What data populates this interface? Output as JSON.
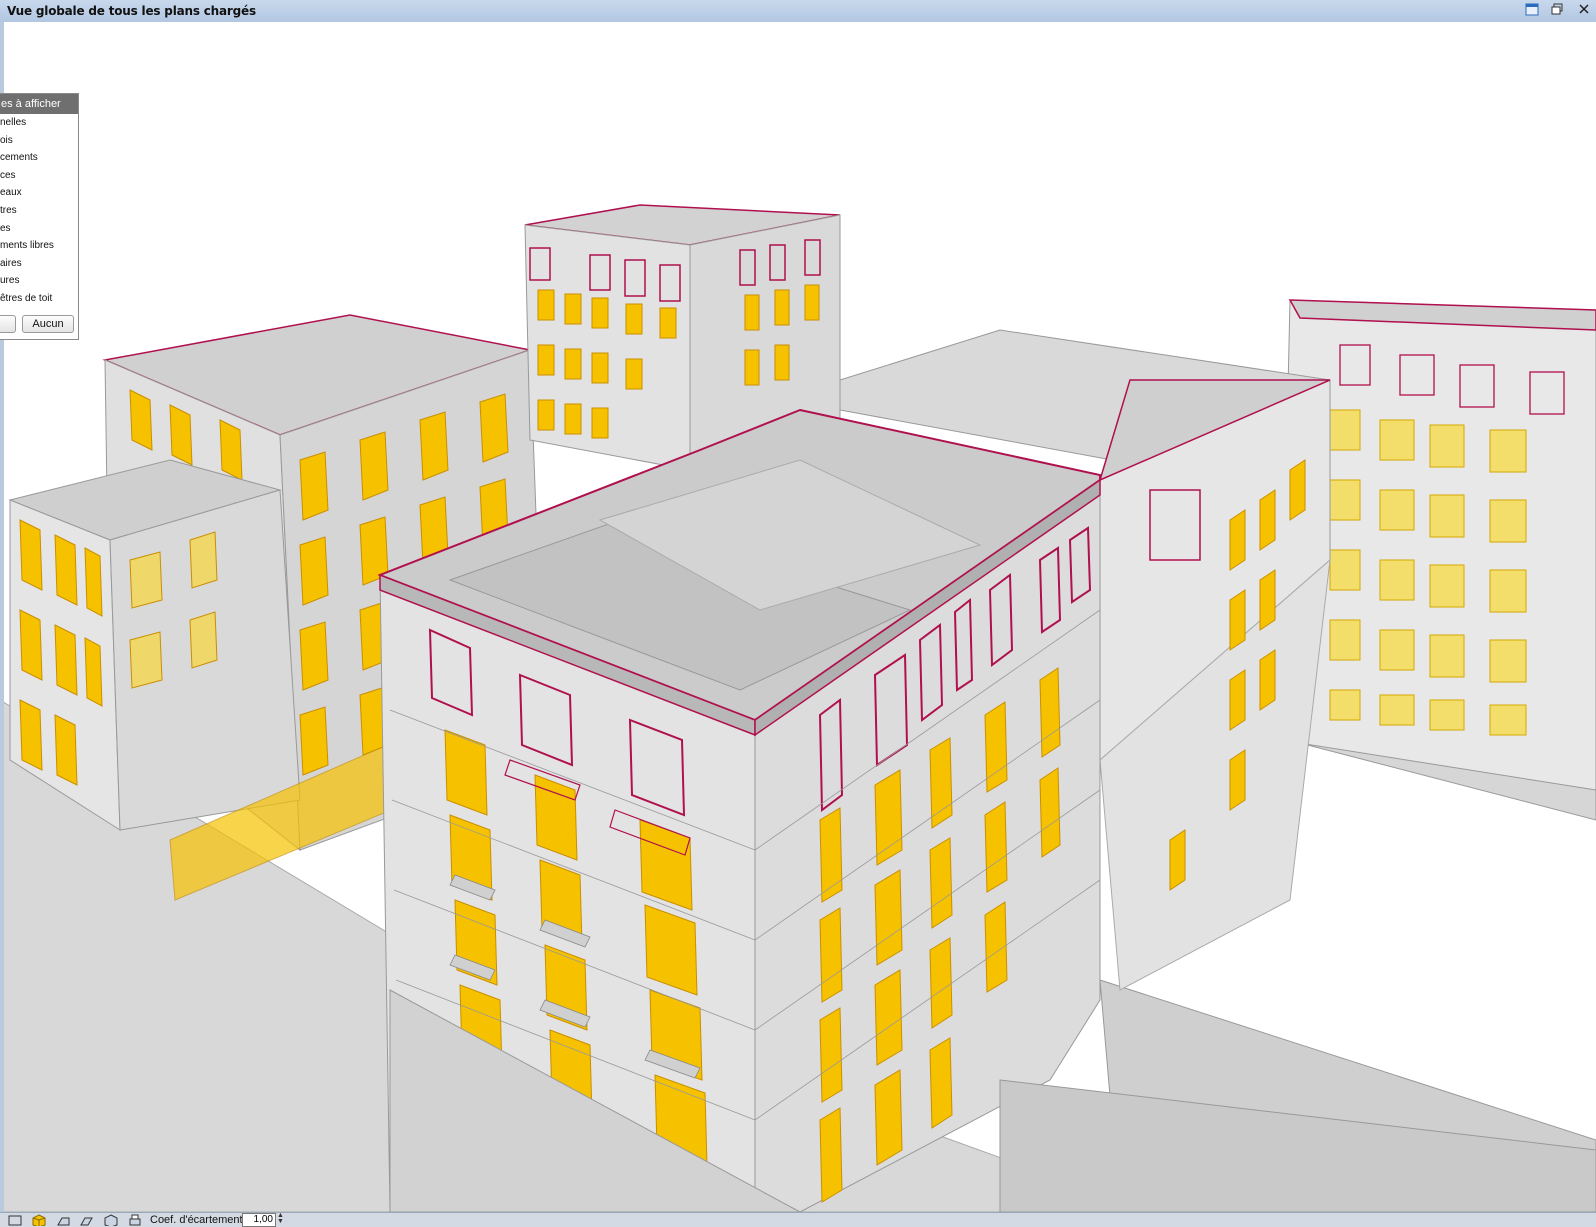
{
  "window": {
    "title": "Vue globale de tous les plans chargés",
    "buttons": [
      "restore-icon",
      "restore-down-icon",
      "close-icon"
    ]
  },
  "layers_panel": {
    "header": "es à afficher",
    "items": [
      "nelles",
      "ois",
      "cements",
      "ces",
      "eaux",
      "tres",
      "es",
      "ments libres",
      "aires",
      "ures",
      "êtres de toit"
    ],
    "btn_none": "Aucun"
  },
  "statusbar": {
    "icons": [
      "plan-view-icon",
      "3d-box-icon",
      "front-view-icon",
      "side-view-icon",
      "iso-view-icon",
      "print-icon"
    ],
    "coef_label": "Coef. d'écartement",
    "coef_value": "1,00"
  },
  "colors": {
    "wall": "#e4e4e4",
    "wall_dark": "#c8c8c8",
    "window_yellow": "#f6c200",
    "glass_yellow": "#fbe98a",
    "magenta_line": "#b0104e",
    "title_bar": "#c4d4ea"
  }
}
